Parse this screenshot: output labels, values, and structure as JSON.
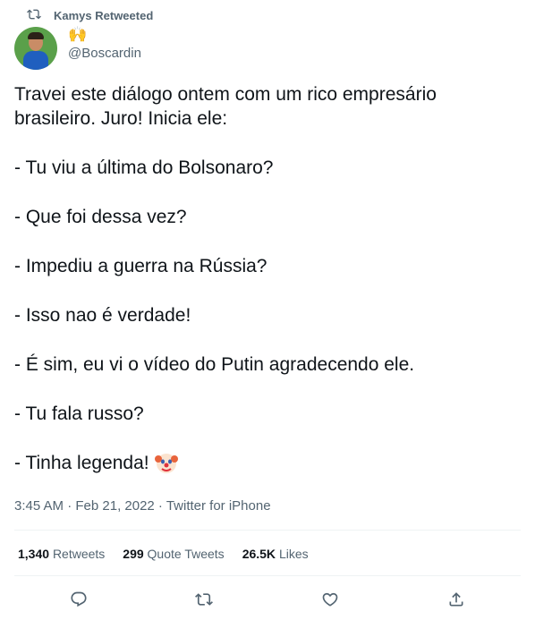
{
  "retweet_header": {
    "icon": "retweet-icon",
    "label": "Kamys Retweeted"
  },
  "author": {
    "display_name": "🙌",
    "handle": "@Boscardin",
    "avatar": "avatar"
  },
  "tweet": {
    "intro": "Travei este diálogo ontem com um rico empresário brasileiro. Juro! Inicia ele:",
    "lines": [
      "- Tu viu a última do Bolsonaro?",
      "- Que foi dessa vez?",
      "- Impediu a guerra na Rússia?",
      "- Isso nao é verdade!",
      "- É sim, eu vi o vídeo do Putin agradecendo ele.",
      "- Tu fala russo?",
      "- Tinha legenda!"
    ],
    "last_emoji": "clown-face-icon"
  },
  "meta": {
    "timestamp": "3:45 AM · Feb 21, 2022 · Twitter for iPhone"
  },
  "stats": {
    "retweets_count": "1,340",
    "retweets_label": "Retweets",
    "quotes_count": "299",
    "quotes_label": "Quote Tweets",
    "likes_count": "26.5K",
    "likes_label": "Likes"
  },
  "actions": [
    "reply-icon",
    "retweet-icon",
    "like-icon",
    "share-icon"
  ],
  "colors": {
    "secondary_text": "#536471",
    "primary_text": "#0f1419",
    "divider": "#eff3f4"
  }
}
